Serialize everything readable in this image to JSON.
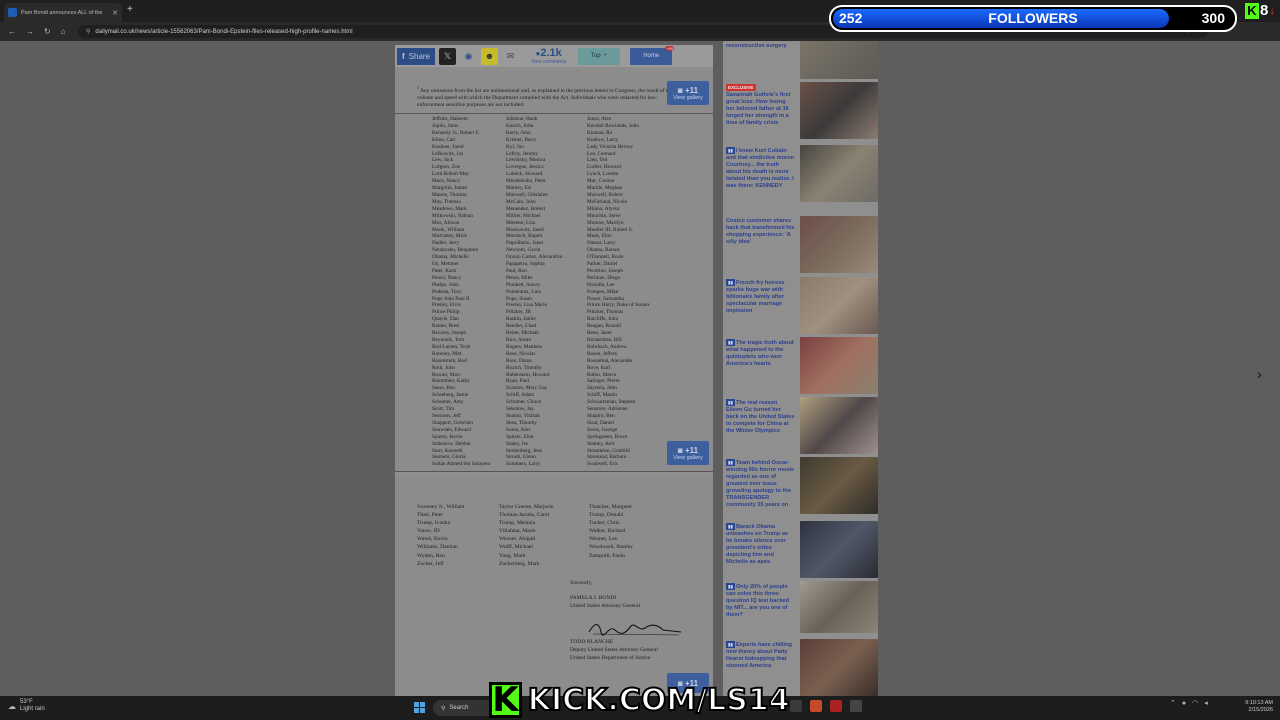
{
  "browser": {
    "tab_title": "Pam Bondi announces ALL of the",
    "url": "dailymail.co.uk/news/article-15562063/Pam-Bondi-Epstein-files-released-high-profile-names.html",
    "update_label": "Refresh to update"
  },
  "sharebar": {
    "share_label": "Share",
    "comments_count": "2.1k",
    "comments_label": "View comments",
    "top_label": "Top",
    "home_label": "Home",
    "home_badge": "+99"
  },
  "document": {
    "footnote_marker": "1",
    "footnote": "Any omissions from the list are unintentional and, as explained in the previous letters to Congress, the result of the volume and speed with which the Department complied with the Act. Individuals who were redacted for law-enforcement sensitive purposes are not included.",
    "col1": [
      "Jeffries, Hakeem",
      "Joplin, Janis",
      "Kennedy Jr., Robert F.",
      "Kline, Carl",
      "Kushner, Jared",
      "Lefkowitz, Jay",
      "Lew, Jack",
      "Lofgren, Zoe",
      "Lord Robert May",
      "Mace, Nancy",
      "Margolin, James",
      "Massie, Thomas",
      "May, Theresa",
      "Meadows, Mark",
      "Milkowski, Nathan",
      "Mos, Allison",
      "Mook, William",
      "Mulvaney, Mick",
      "Nadler, Jerry",
      "Netanyahu, Benjamin",
      "Obama, Michelle",
      "Oz, Mehmet",
      "Patel, Kash",
      "Pelosi, Nancy",
      "Phelps, John",
      "Podesta, Tony",
      "Pope John Paul II",
      "Presley, Elvis",
      "Prince Philip",
      "Quayle, Dan",
      "Ratner, Brett",
      "Recarey, Joseph",
      "Reynolds, Tom",
      "Rod-Larsen, Terje",
      "Romney, Mitt",
      "Rosenstein, Rod",
      "Roth, John",
      "Rowan, Marc",
      "Ruemmler, Kathy",
      "Sasse, Ben",
      "Schreberg, Jamie",
      "Schumer, Amy",
      "Scott, Tim",
      "Sessions, Jeff",
      "Shappert, Gretchen",
      "Snowden, Edward",
      "Spacey, Kevin",
      "Stabenow, Debbie",
      "Starr, Kenneth",
      "Steinem, Gloria",
      "Sultan Ahmed bin Sulayem"
    ],
    "col2": [
      "Johnson, Hank",
      "Kaslch, John",
      "Kerry, John",
      "Krisher, Barry",
      "Kyl, Jon",
      "Lefroy, Jeremy",
      "Lewinsky, Monica",
      "Lovergne, Jessica",
      "Lutnick, Howard",
      "Mendelsohn, Peter",
      "Markey, Ed",
      "Maxwell, Ghislaine",
      "McCain, John",
      "Menendez, Robert",
      "Millier, Michael",
      "Moeeno, Lisa",
      "Moskowitz, Jared",
      "Murdoch, Rupert",
      "Napolitano, Janet",
      "Newsom, Gavin",
      "Ocasio Cortez, Alexandria",
      "Papapetru, Sophia",
      "Paul, Ron",
      "Pence, Mike",
      "Plunkett, Stacey",
      "Pomerantz, Lara",
      "Pope, Susan",
      "Presley, Lisa Marie",
      "Pritzker, JB",
      "Raskin, Jamie",
      "Reedler, Chad",
      "Reiter, Michael",
      "Rice, Susan",
      "Rogers, Matthew",
      "Rose, Nicolas",
      "Ross, Diana",
      "Rozich, Timothy",
      "Rubenstein, Howard",
      "Ryan, Paul",
      "Scanlon, Mary Gay",
      "Schiff, Adam",
      "Schumer, Chuck",
      "Sekulow, Jay",
      "Shamir, Yitzhak",
      "Shea, Timothy",
      "Soros, Alex",
      "Spitzer, Eliot",
      "Staley, Jes",
      "Stoltenberg, Jens",
      "Stroub, Glenn",
      "Summers, Larry"
    ],
    "col3": [
      "Jones, Alex",
      "Kendall Rowlands, John",
      "Khanna, Ro",
      "Kudlow, Larry",
      "Lady Victoria Hervey",
      "Leo, Leonard",
      "Lieu, Ted",
      "Lorber, Howard",
      "Lynch, Loretta",
      "Mac, Connor",
      "Markle, Meghan",
      "Maxwell, Robert",
      "McFarland, Nicole",
      "Milano, Alyssa",
      "Mnuchin, Steve",
      "Monroe, Marilyn",
      "Mueller III, Robert S.",
      "Musk, Elon",
      "Nassar, Larry",
      "Obama, Barack",
      "O'Donnell, Rosie",
      "Parker, Daniel",
      "Pecorino, Joseph",
      "Perlman, Diego",
      "Pinsolle, Lee",
      "Pompeo, Mike",
      "Power, Samantha",
      "Prince Harry, Duke of Sussex",
      "Pritzker, Thomas",
      "Ratcliffe, John",
      "Reagan, Ronald",
      "Reno, Janet",
      "Richardson, Bill",
      "Rohrbach, Andrew",
      "Rosen, Jeffrey",
      "Rosenthal, Alexander",
      "Rove, Karl",
      "Rubio, Marco",
      "Salinger, Pierre",
      "Saynola, John",
      "Schiff, Martin",
      "Schwartzman, Stephen",
      "Senatore, Adrienne",
      "Shapiro, Ben",
      "Sisal, Daniel",
      "Soros, George",
      "Springsteen, Bruce",
      "Stamey, Keir",
      "Strandelen, Gonhild",
      "Streisand, Barbara",
      "Swalwell, Eric"
    ],
    "page2_col1": [
      "Sweeney Jr., William",
      "Thiel, Peter",
      "Trump, Ivanka",
      "Vance, JD",
      "Warsh, Kevin",
      "Williams, Damian",
      "Wyden, Ron",
      "Zucker, Jeff"
    ],
    "page2_col2": [
      "Taylor Greene, Marjorie",
      "Thomas-Jacobs, Carol",
      "Trump, Melania",
      "Villafana, Marie",
      "Wexner, Abigail",
      "Wolff, Michael",
      "Yang, Mark",
      "Zuckerberg, Mark"
    ],
    "page2_col3": [
      "Thatcher, Margaret",
      "Trump, Donald",
      "Tucker, Chris",
      "Walker, Richard",
      "Wexner, Les",
      "Woodward, Stanley",
      "Zampolli, Paolo"
    ],
    "closing": "Sincerely,",
    "signer1_name": "PAMELA J. BONDI",
    "signer1_title": "United States Attorney General",
    "signer2_name": "TODD BLANCHE",
    "signer2_title1": "Deputy United States Attorney General",
    "signer2_title2": "United States Department of Justice",
    "signature_text": "Todd Blanche"
  },
  "gallery": {
    "count": "+11",
    "label": "View gallery"
  },
  "sidebar": {
    "items": [
      {
        "tag": "",
        "text": "reconstructive surgery"
      },
      {
        "tag": "EXCLUSIVE",
        "text": "Savannah Guthrie's first great loss: How losing her beloved father at 16 forged her strength in a time of family crisis"
      },
      {
        "tag": "",
        "text": "I knew Kurt Cobain and that vindictive moron Courtney... the truth about his death is more twisted than you realize. I was there: KENNEDY"
      },
      {
        "tag": "",
        "text": "Costco customer shares hack that transformed his shopping experience: 'A silly idea'"
      },
      {
        "tag": "",
        "text": "French fry heiress sparks huge war with billionaire family after spectacular marriage implosion"
      },
      {
        "tag": "",
        "text": "The tragic truth about what happened to the quintuplets who won America's hearts"
      },
      {
        "tag": "",
        "text": "The real reason Eileen Gu turned her back on the United States to compete for China at the Winter Olympics"
      },
      {
        "tag": "",
        "text": "Team behind Oscar-winning 90s horror movie regarded as one of greatest ever issue groveling apology to the TRANSGENDER community 35 years on"
      },
      {
        "tag": "",
        "text": "Barack Obama unleashes on Trump as he breaks silence over president's video depicting him and Michelle as apes"
      },
      {
        "tag": "",
        "text": "Only 20% of people can solve this three-question IQ test backed by MIT... are you one of them?"
      },
      {
        "tag": "",
        "text": "Experts have chilling new theory about Patty Hearst kidnapping that stunned America"
      }
    ]
  },
  "taskbar": {
    "weather_temp": "53°F",
    "weather_desc": "Light rain",
    "search_label": "Search",
    "time": "9:10:13 AM",
    "date": "2/15/2026"
  },
  "overlay": {
    "kick_text": "KICK.COM/LS14",
    "kick_logo": "K",
    "followers_current": "252",
    "followers_label": "FOLLOWERS",
    "followers_goal": "300",
    "followers_progress": 0.84,
    "viewer_count": "8"
  },
  "colors": {
    "kick_green": "#53fc18",
    "link_blue": "#2b3f8f",
    "followers_blue": "#1a6bff"
  }
}
